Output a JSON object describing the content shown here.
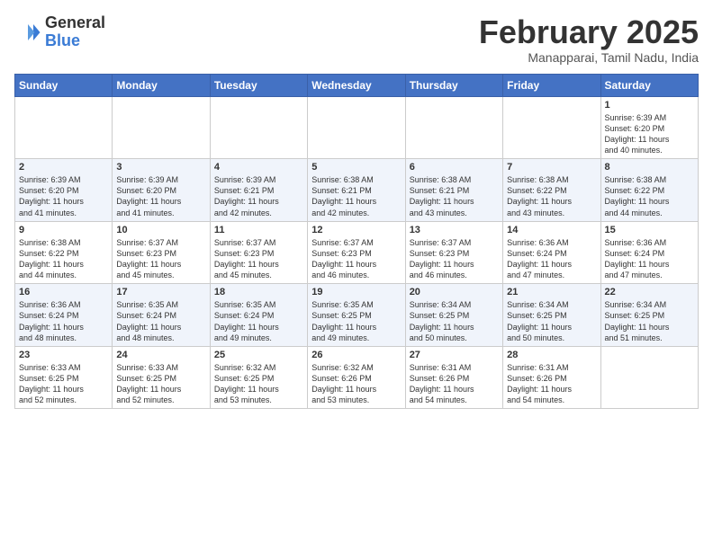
{
  "logo": {
    "general": "General",
    "blue": "Blue"
  },
  "header": {
    "month": "February 2025",
    "location": "Manapparai, Tamil Nadu, India"
  },
  "weekdays": [
    "Sunday",
    "Monday",
    "Tuesday",
    "Wednesday",
    "Thursday",
    "Friday",
    "Saturday"
  ],
  "weeks": [
    [
      {
        "day": "",
        "info": ""
      },
      {
        "day": "",
        "info": ""
      },
      {
        "day": "",
        "info": ""
      },
      {
        "day": "",
        "info": ""
      },
      {
        "day": "",
        "info": ""
      },
      {
        "day": "",
        "info": ""
      },
      {
        "day": "1",
        "info": "Sunrise: 6:39 AM\nSunset: 6:20 PM\nDaylight: 11 hours\nand 40 minutes."
      }
    ],
    [
      {
        "day": "2",
        "info": "Sunrise: 6:39 AM\nSunset: 6:20 PM\nDaylight: 11 hours\nand 41 minutes."
      },
      {
        "day": "3",
        "info": "Sunrise: 6:39 AM\nSunset: 6:20 PM\nDaylight: 11 hours\nand 41 minutes."
      },
      {
        "day": "4",
        "info": "Sunrise: 6:39 AM\nSunset: 6:21 PM\nDaylight: 11 hours\nand 42 minutes."
      },
      {
        "day": "5",
        "info": "Sunrise: 6:38 AM\nSunset: 6:21 PM\nDaylight: 11 hours\nand 42 minutes."
      },
      {
        "day": "6",
        "info": "Sunrise: 6:38 AM\nSunset: 6:21 PM\nDaylight: 11 hours\nand 43 minutes."
      },
      {
        "day": "7",
        "info": "Sunrise: 6:38 AM\nSunset: 6:22 PM\nDaylight: 11 hours\nand 43 minutes."
      },
      {
        "day": "8",
        "info": "Sunrise: 6:38 AM\nSunset: 6:22 PM\nDaylight: 11 hours\nand 44 minutes."
      }
    ],
    [
      {
        "day": "9",
        "info": "Sunrise: 6:38 AM\nSunset: 6:22 PM\nDaylight: 11 hours\nand 44 minutes."
      },
      {
        "day": "10",
        "info": "Sunrise: 6:37 AM\nSunset: 6:23 PM\nDaylight: 11 hours\nand 45 minutes."
      },
      {
        "day": "11",
        "info": "Sunrise: 6:37 AM\nSunset: 6:23 PM\nDaylight: 11 hours\nand 45 minutes."
      },
      {
        "day": "12",
        "info": "Sunrise: 6:37 AM\nSunset: 6:23 PM\nDaylight: 11 hours\nand 46 minutes."
      },
      {
        "day": "13",
        "info": "Sunrise: 6:37 AM\nSunset: 6:23 PM\nDaylight: 11 hours\nand 46 minutes."
      },
      {
        "day": "14",
        "info": "Sunrise: 6:36 AM\nSunset: 6:24 PM\nDaylight: 11 hours\nand 47 minutes."
      },
      {
        "day": "15",
        "info": "Sunrise: 6:36 AM\nSunset: 6:24 PM\nDaylight: 11 hours\nand 47 minutes."
      }
    ],
    [
      {
        "day": "16",
        "info": "Sunrise: 6:36 AM\nSunset: 6:24 PM\nDaylight: 11 hours\nand 48 minutes."
      },
      {
        "day": "17",
        "info": "Sunrise: 6:35 AM\nSunset: 6:24 PM\nDaylight: 11 hours\nand 48 minutes."
      },
      {
        "day": "18",
        "info": "Sunrise: 6:35 AM\nSunset: 6:24 PM\nDaylight: 11 hours\nand 49 minutes."
      },
      {
        "day": "19",
        "info": "Sunrise: 6:35 AM\nSunset: 6:25 PM\nDaylight: 11 hours\nand 49 minutes."
      },
      {
        "day": "20",
        "info": "Sunrise: 6:34 AM\nSunset: 6:25 PM\nDaylight: 11 hours\nand 50 minutes."
      },
      {
        "day": "21",
        "info": "Sunrise: 6:34 AM\nSunset: 6:25 PM\nDaylight: 11 hours\nand 50 minutes."
      },
      {
        "day": "22",
        "info": "Sunrise: 6:34 AM\nSunset: 6:25 PM\nDaylight: 11 hours\nand 51 minutes."
      }
    ],
    [
      {
        "day": "23",
        "info": "Sunrise: 6:33 AM\nSunset: 6:25 PM\nDaylight: 11 hours\nand 52 minutes."
      },
      {
        "day": "24",
        "info": "Sunrise: 6:33 AM\nSunset: 6:25 PM\nDaylight: 11 hours\nand 52 minutes."
      },
      {
        "day": "25",
        "info": "Sunrise: 6:32 AM\nSunset: 6:25 PM\nDaylight: 11 hours\nand 53 minutes."
      },
      {
        "day": "26",
        "info": "Sunrise: 6:32 AM\nSunset: 6:26 PM\nDaylight: 11 hours\nand 53 minutes."
      },
      {
        "day": "27",
        "info": "Sunrise: 6:31 AM\nSunset: 6:26 PM\nDaylight: 11 hours\nand 54 minutes."
      },
      {
        "day": "28",
        "info": "Sunrise: 6:31 AM\nSunset: 6:26 PM\nDaylight: 11 hours\nand 54 minutes."
      },
      {
        "day": "",
        "info": ""
      }
    ]
  ]
}
